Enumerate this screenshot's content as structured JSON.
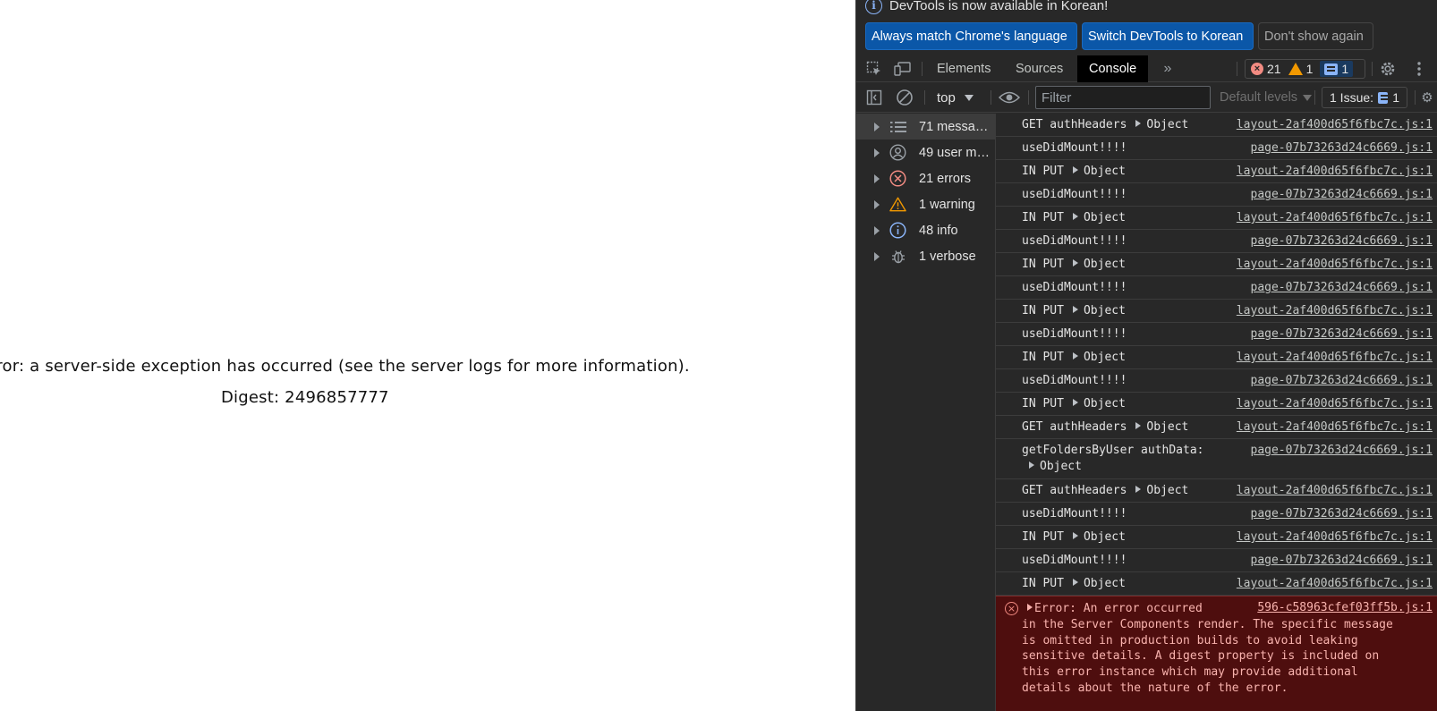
{
  "page": {
    "error_message": "rror: a server-side exception has occurred (see the server logs for more information).",
    "digest": "Digest: 2496857777"
  },
  "infobar": {
    "title": "DevTools is now available in Korean!",
    "buttons": [
      {
        "label": "Always match Chrome's language"
      },
      {
        "label": "Switch DevTools to Korean"
      },
      {
        "label": "Don't show again"
      }
    ]
  },
  "tabs": [
    {
      "label": "Elements",
      "active": false
    },
    {
      "label": "Sources",
      "active": false
    },
    {
      "label": "Console",
      "active": true
    }
  ],
  "counts": {
    "errors": "21",
    "warnings": "1",
    "messages": "1"
  },
  "toolbar": {
    "context": "top",
    "filter_placeholder": "Filter",
    "levels": "Default levels",
    "issues_label": "1 Issue:",
    "issues_count": "1"
  },
  "sidebar": {
    "items": [
      {
        "label": "71 messages",
        "icon": "list-icon"
      },
      {
        "label": "49 user me...",
        "icon": "user-icon"
      },
      {
        "label": "21 errors",
        "icon": "error-icon"
      },
      {
        "label": "1 warning",
        "icon": "warning-icon"
      },
      {
        "label": "48 info",
        "icon": "info-icon"
      },
      {
        "label": "1 verbose",
        "icon": "bug-icon"
      }
    ]
  },
  "console": {
    "rows": [
      {
        "text": "GET authHeaders",
        "obj": "Object",
        "source": "layout-2af400d65f6fbc7c.js:1"
      },
      {
        "text": "useDidMount!!!!",
        "obj": "",
        "source": "page-07b73263d24c6669.js:1"
      },
      {
        "text": "IN PUT",
        "obj": "Object",
        "source": "layout-2af400d65f6fbc7c.js:1"
      },
      {
        "text": "useDidMount!!!!",
        "obj": "",
        "source": "page-07b73263d24c6669.js:1"
      },
      {
        "text": "IN PUT",
        "obj": "Object",
        "source": "layout-2af400d65f6fbc7c.js:1"
      },
      {
        "text": "useDidMount!!!!",
        "obj": "",
        "source": "page-07b73263d24c6669.js:1"
      },
      {
        "text": "IN PUT",
        "obj": "Object",
        "source": "layout-2af400d65f6fbc7c.js:1"
      },
      {
        "text": "useDidMount!!!!",
        "obj": "",
        "source": "page-07b73263d24c6669.js:1"
      },
      {
        "text": "IN PUT",
        "obj": "Object",
        "source": "layout-2af400d65f6fbc7c.js:1"
      },
      {
        "text": "useDidMount!!!!",
        "obj": "",
        "source": "page-07b73263d24c6669.js:1"
      },
      {
        "text": "IN PUT",
        "obj": "Object",
        "source": "layout-2af400d65f6fbc7c.js:1"
      },
      {
        "text": "useDidMount!!!!",
        "obj": "",
        "source": "page-07b73263d24c6669.js:1"
      },
      {
        "text": "IN PUT",
        "obj": "Object",
        "source": "layout-2af400d65f6fbc7c.js:1"
      },
      {
        "text": "GET authHeaders",
        "obj": "Object",
        "source": "layout-2af400d65f6fbc7c.js:1"
      },
      {
        "text": "getFoldersByUser authData:",
        "obj": "",
        "obj2": "Object",
        "source": "page-07b73263d24c6669.js:1"
      },
      {
        "text": "GET authHeaders",
        "obj": "Object",
        "source": "layout-2af400d65f6fbc7c.js:1"
      },
      {
        "text": "useDidMount!!!!",
        "obj": "",
        "source": "page-07b73263d24c6669.js:1"
      },
      {
        "text": "IN PUT",
        "obj": "Object",
        "source": "layout-2af400d65f6fbc7c.js:1"
      },
      {
        "text": "useDidMount!!!!",
        "obj": "",
        "source": "page-07b73263d24c6669.js:1"
      },
      {
        "text": "IN PUT",
        "obj": "Object",
        "source": "layout-2af400d65f6fbc7c.js:1"
      }
    ],
    "error": {
      "head": "Error: An error occurred",
      "body": "in the Server Components render. The specific message\nis omitted in production builds to avoid leaking\nsensitive details. A digest property is included on\nthis error instance which may provide additional\ndetails about the nature of the error.",
      "source": "596-c58963cfef03ff5b.js:1"
    }
  },
  "colors": {
    "devtools_bg": "#282828",
    "primary_button": "#0b57a8",
    "error_bg": "#4e0e0e",
    "error_text": "#f9b3ae",
    "info_blue": "#8ab4f8",
    "warning": "#f29900"
  }
}
